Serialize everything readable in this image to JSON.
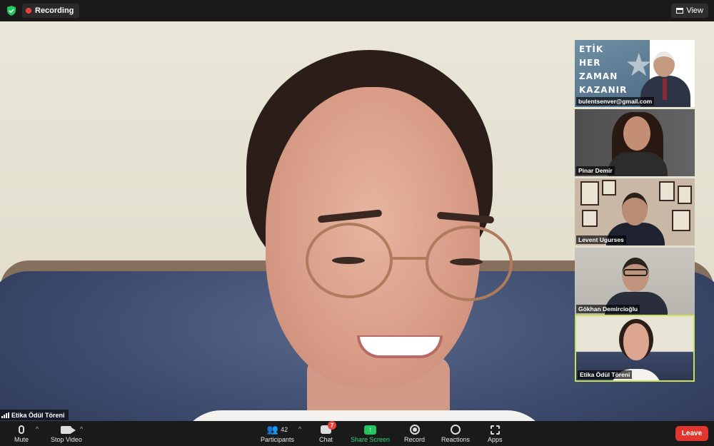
{
  "topbar": {
    "recording_label": "Recording",
    "view_label": "View"
  },
  "main": {
    "speaker_name": "Etika Ödül Töreni"
  },
  "gallery": [
    {
      "name": "bulentsenver@gmail.com",
      "poster_text": [
        "ETİK",
        "HER",
        "ZAMAN",
        "KAZANIR"
      ]
    },
    {
      "name": "Pinar Demir"
    },
    {
      "name": "Levent Ugurses"
    },
    {
      "name": "Gökhan Demircioğlu"
    },
    {
      "name": "Etika Ödül Töreni",
      "active": true
    }
  ],
  "toolbar": {
    "mute_label": "Mute",
    "stop_video_label": "Stop Video",
    "participants_label": "Participants",
    "participants_count": "42",
    "chat_label": "Chat",
    "chat_badge": "7",
    "share_label": "Share Screen",
    "record_label": "Record",
    "reactions_label": "Reactions",
    "apps_label": "Apps",
    "leave_label": "Leave"
  },
  "colors": {
    "recording": "#e8413c",
    "share": "#23c55e",
    "leave": "#e0362e",
    "active_tile_border": "#c8e05a"
  }
}
